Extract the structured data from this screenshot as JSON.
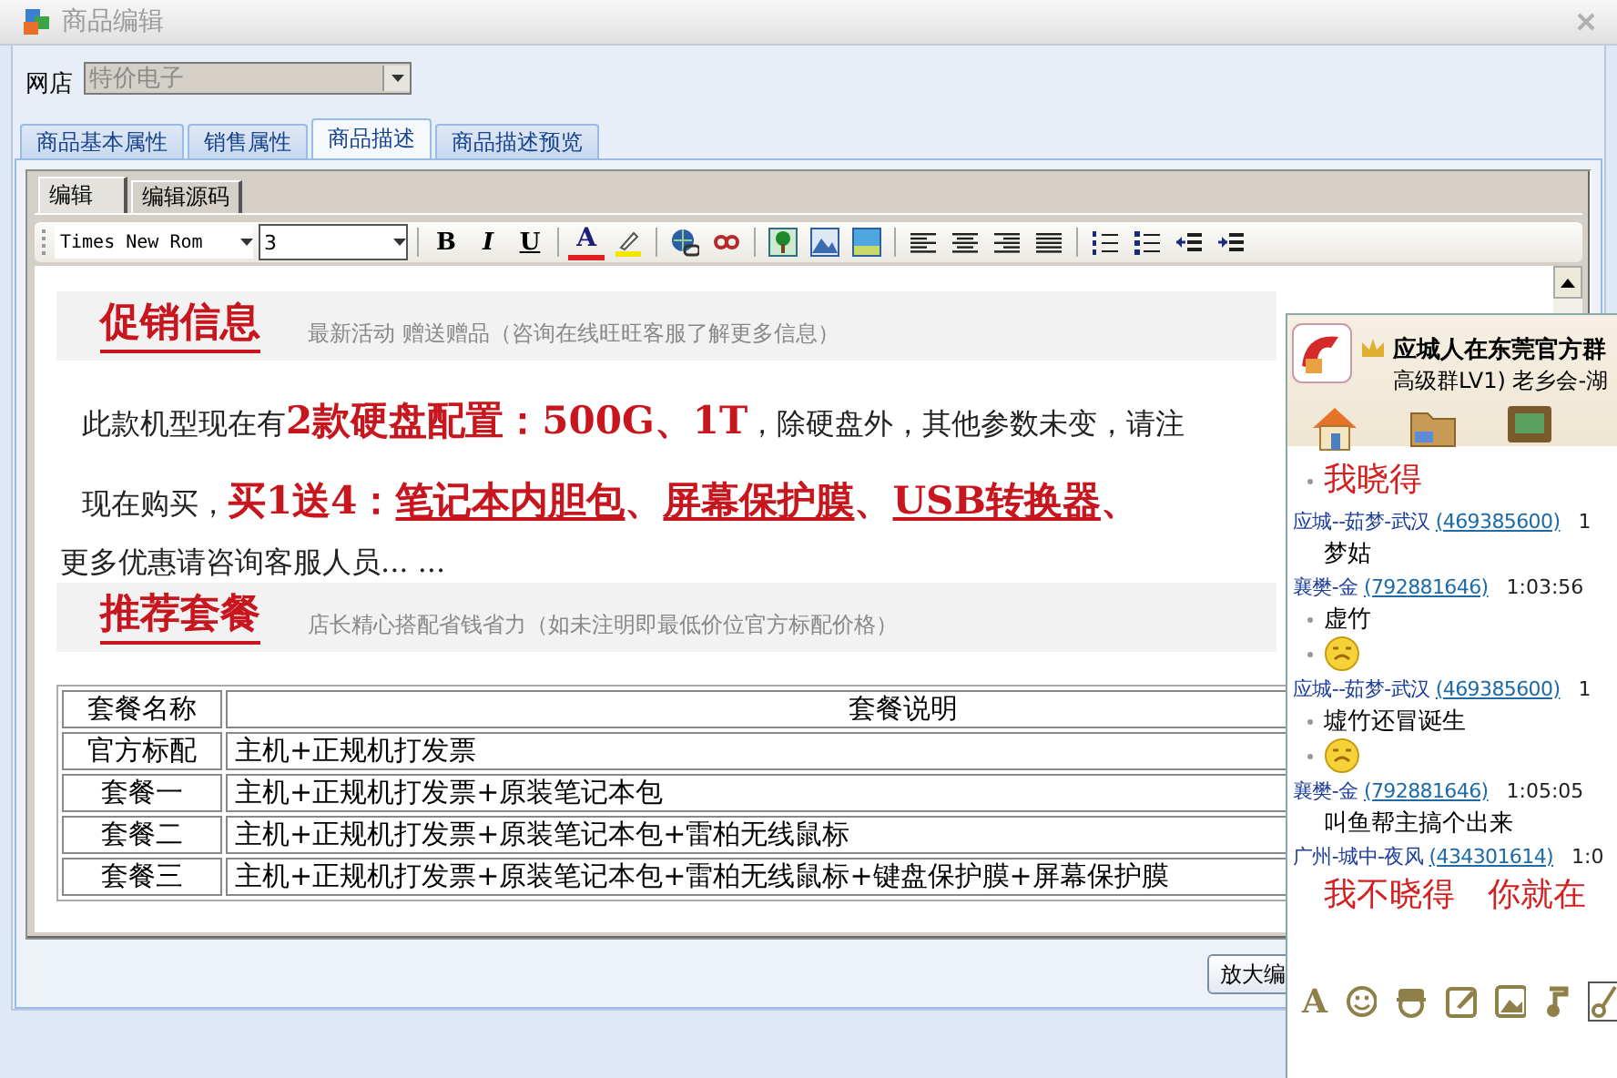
{
  "window": {
    "title": "商品编辑"
  },
  "shop": {
    "label": "网店",
    "value": "特价电子",
    "disabled": true
  },
  "tabs": [
    {
      "label": "商品基本属性",
      "selected": false
    },
    {
      "label": "销售属性",
      "selected": false
    },
    {
      "label": "商品描述",
      "selected": true
    },
    {
      "label": "商品描述预览",
      "selected": false
    }
  ],
  "editor_tabs": [
    {
      "label": "编辑",
      "selected": true
    },
    {
      "label": "编辑源码",
      "selected": false
    }
  ],
  "toolbar": {
    "font": "Times New Rom",
    "size": "3",
    "format_buttons": [
      "B",
      "I",
      "U"
    ],
    "font_color": "A"
  },
  "promo": {
    "title": "促销信息",
    "subtitle": "最新活动 赠送赠品（咨询在线旺旺客服了解更多信息）",
    "paragraphs": [
      {
        "segments": [
          {
            "kind": "plain",
            "text": "此款机型现在有"
          },
          {
            "kind": "emphasis",
            "text": "2款硬盘配置：500G、1T"
          },
          {
            "kind": "plain",
            "text": "，除硬盘外，其他参数未变，请注"
          }
        ]
      },
      {
        "segments": [
          {
            "kind": "plain",
            "text": "现在购买，"
          },
          {
            "kind": "emphasis",
            "text": "买1送4："
          },
          {
            "kind": "underlined",
            "text": "笔记本内胆包"
          },
          {
            "kind": "emphasis",
            "text": "、"
          },
          {
            "kind": "underlined",
            "text": "屏幕保护膜"
          },
          {
            "kind": "emphasis",
            "text": "、"
          },
          {
            "kind": "underlined",
            "text": "USB转换器"
          },
          {
            "kind": "emphasis",
            "text": "、"
          }
        ]
      }
    ],
    "note": "更多优惠请咨询客服人员... ..."
  },
  "packages": {
    "title": "推荐套餐",
    "subtitle": "店长精心搭配省钱省力（如未注明即最低价位官方标配价格）",
    "columns": [
      "套餐名称",
      "套餐说明"
    ],
    "rows": [
      [
        "官方标配",
        "主机+正规机打发票"
      ],
      [
        "套餐一",
        "主机+正规机打发票+原装笔记本包"
      ],
      [
        "套餐二",
        "主机+正规机打发票+原装笔记本包+雷柏无线鼠标"
      ],
      [
        "套餐三",
        "主机+正规机打发票+原装笔记本包+雷柏无线鼠标+键盘保护膜+屏幕保护膜"
      ]
    ]
  },
  "zoom_button": "放大编",
  "chat": {
    "group_name": "应城人在东莞官方群",
    "group_info": "高级群LV1) 老乡会-湖",
    "messages": [
      {
        "kind": "big",
        "text": "我晓得",
        "bullet": true
      },
      {
        "kind": "sender",
        "name": "应城--茹梦-武汉",
        "id": "(469385600)",
        "time": "1"
      },
      {
        "kind": "text",
        "text": "梦姑",
        "bullet": false
      },
      {
        "kind": "sender",
        "name": "襄樊-金",
        "id": "(792881646)",
        "time": "1:03:56"
      },
      {
        "kind": "text",
        "text": "虚竹",
        "bullet": true
      },
      {
        "kind": "emoji",
        "bullet": true
      },
      {
        "kind": "sender",
        "name": "应城--茹梦-武汉",
        "id": "(469385600)",
        "time": "1"
      },
      {
        "kind": "text",
        "text": "墟竹还冒诞生",
        "bullet": true
      },
      {
        "kind": "emoji",
        "bullet": true
      },
      {
        "kind": "sender",
        "name": "襄樊-金",
        "id": "(792881646)",
        "time": "1:05:05"
      },
      {
        "kind": "text",
        "text": "叫鱼帮主搞个出来",
        "bullet": false
      },
      {
        "kind": "sender",
        "name": "广州-城中-夜风",
        "id": "(434301614)",
        "time": "1:0"
      },
      {
        "kind": "big",
        "text": "我不晓得　你就在",
        "bullet": false
      }
    ],
    "font_button": "A"
  }
}
